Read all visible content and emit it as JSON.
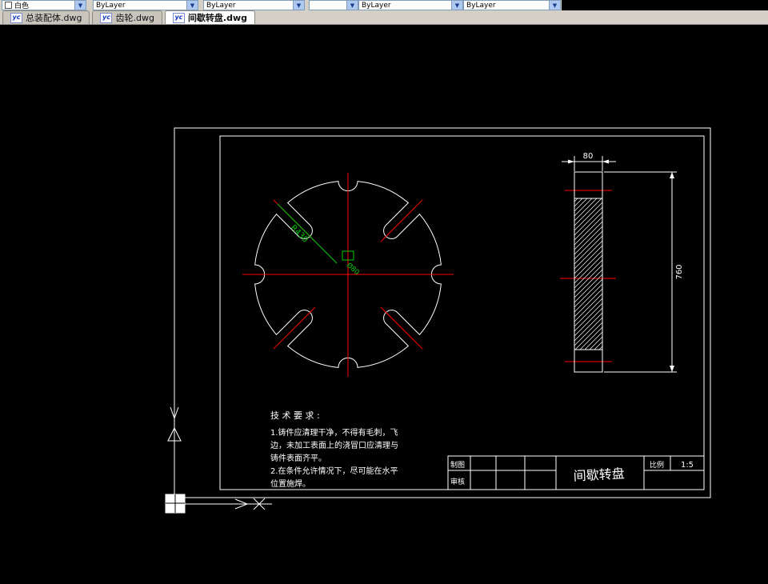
{
  "toolbar": {
    "combos": [
      {
        "text": "白色"
      },
      {
        "text": "ByLayer"
      },
      {
        "text": "ByLayer"
      },
      {
        "text": ""
      },
      {
        "text": "ByLayer"
      },
      {
        "text": "ByLayer"
      }
    ]
  },
  "tabs": [
    {
      "label": "总装配体.dwg"
    },
    {
      "label": "齿轮.dwg"
    },
    {
      "label": "间歇转盘.dwg"
    }
  ],
  "drawing": {
    "colors": {
      "outline": "#ffffff",
      "centerline": "#ff0000",
      "annotation": "#00cc00"
    },
    "front_view": {
      "radius_label": "R430",
      "center_label": "Ø80"
    },
    "side_view": {
      "width_label": "80",
      "height_label": "760"
    },
    "tech_requirements": {
      "title": "技 术 要 求 :",
      "line1": "1.铸件应清理干净，不得有毛刺，飞",
      "line2": "边，未加工表面上的浇冒口应清理与",
      "line3": "铸件表面齐平。",
      "line4": "2.在条件允许情况下，尽可能在水平",
      "line5": "位置施焊。"
    },
    "title_block": {
      "row1_label": "制图",
      "row2_label": "审核",
      "part_name": "间歇转盘",
      "scale_label": "比例",
      "scale_value": "1:5"
    }
  }
}
